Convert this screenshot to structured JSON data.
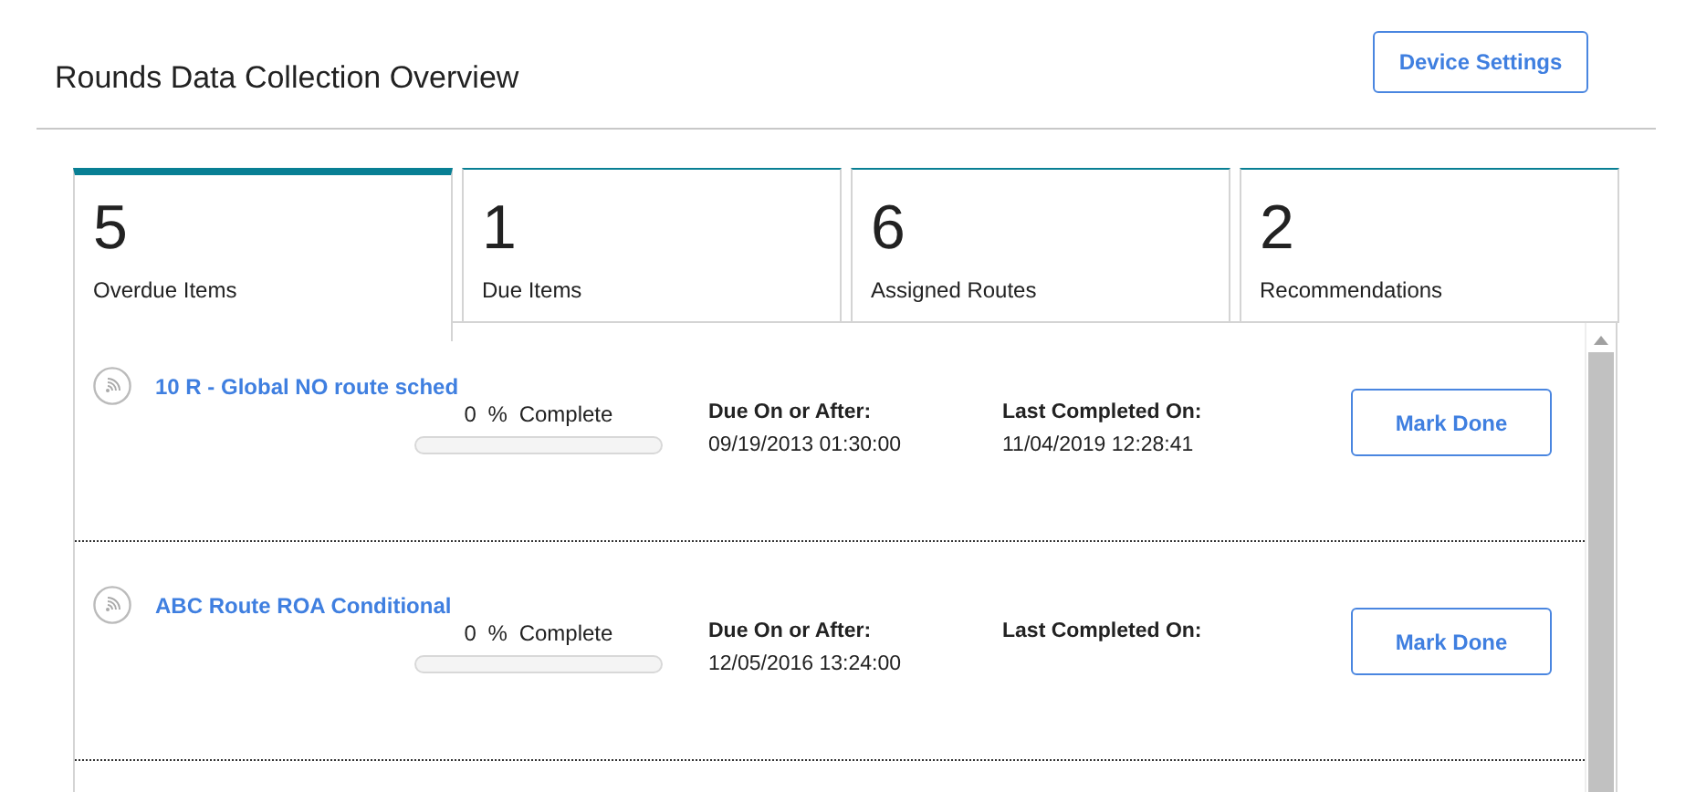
{
  "header": {
    "title": "Rounds Data Collection Overview",
    "button": "Device Settings"
  },
  "tabs": [
    {
      "count": "5",
      "label": "Overdue Items",
      "selected": true
    },
    {
      "count": "1",
      "label": "Due Items",
      "selected": false
    },
    {
      "count": "6",
      "label": "Assigned Routes",
      "selected": false
    },
    {
      "count": "2",
      "label": "Recommendations",
      "selected": false
    }
  ],
  "routes": [
    {
      "name": "10 R - Global NO route sched",
      "percent": "0 %",
      "progress_label": "Complete",
      "level": 0,
      "due_label": "Due On or After:",
      "due": "09/19/2013 01:30:00",
      "last_label": "Last Completed On:",
      "last": "11/04/2019 12:28:41",
      "button": "Mark Done"
    },
    {
      "name": "ABC Route ROA Conditional",
      "percent": "0 %",
      "progress_label": "Complete",
      "level": 0,
      "due_label": "Due On or After:",
      "due": "12/05/2016 13:24:00",
      "last_label": "Last Completed On:",
      "button": "Mark Done"
    }
  ]
}
